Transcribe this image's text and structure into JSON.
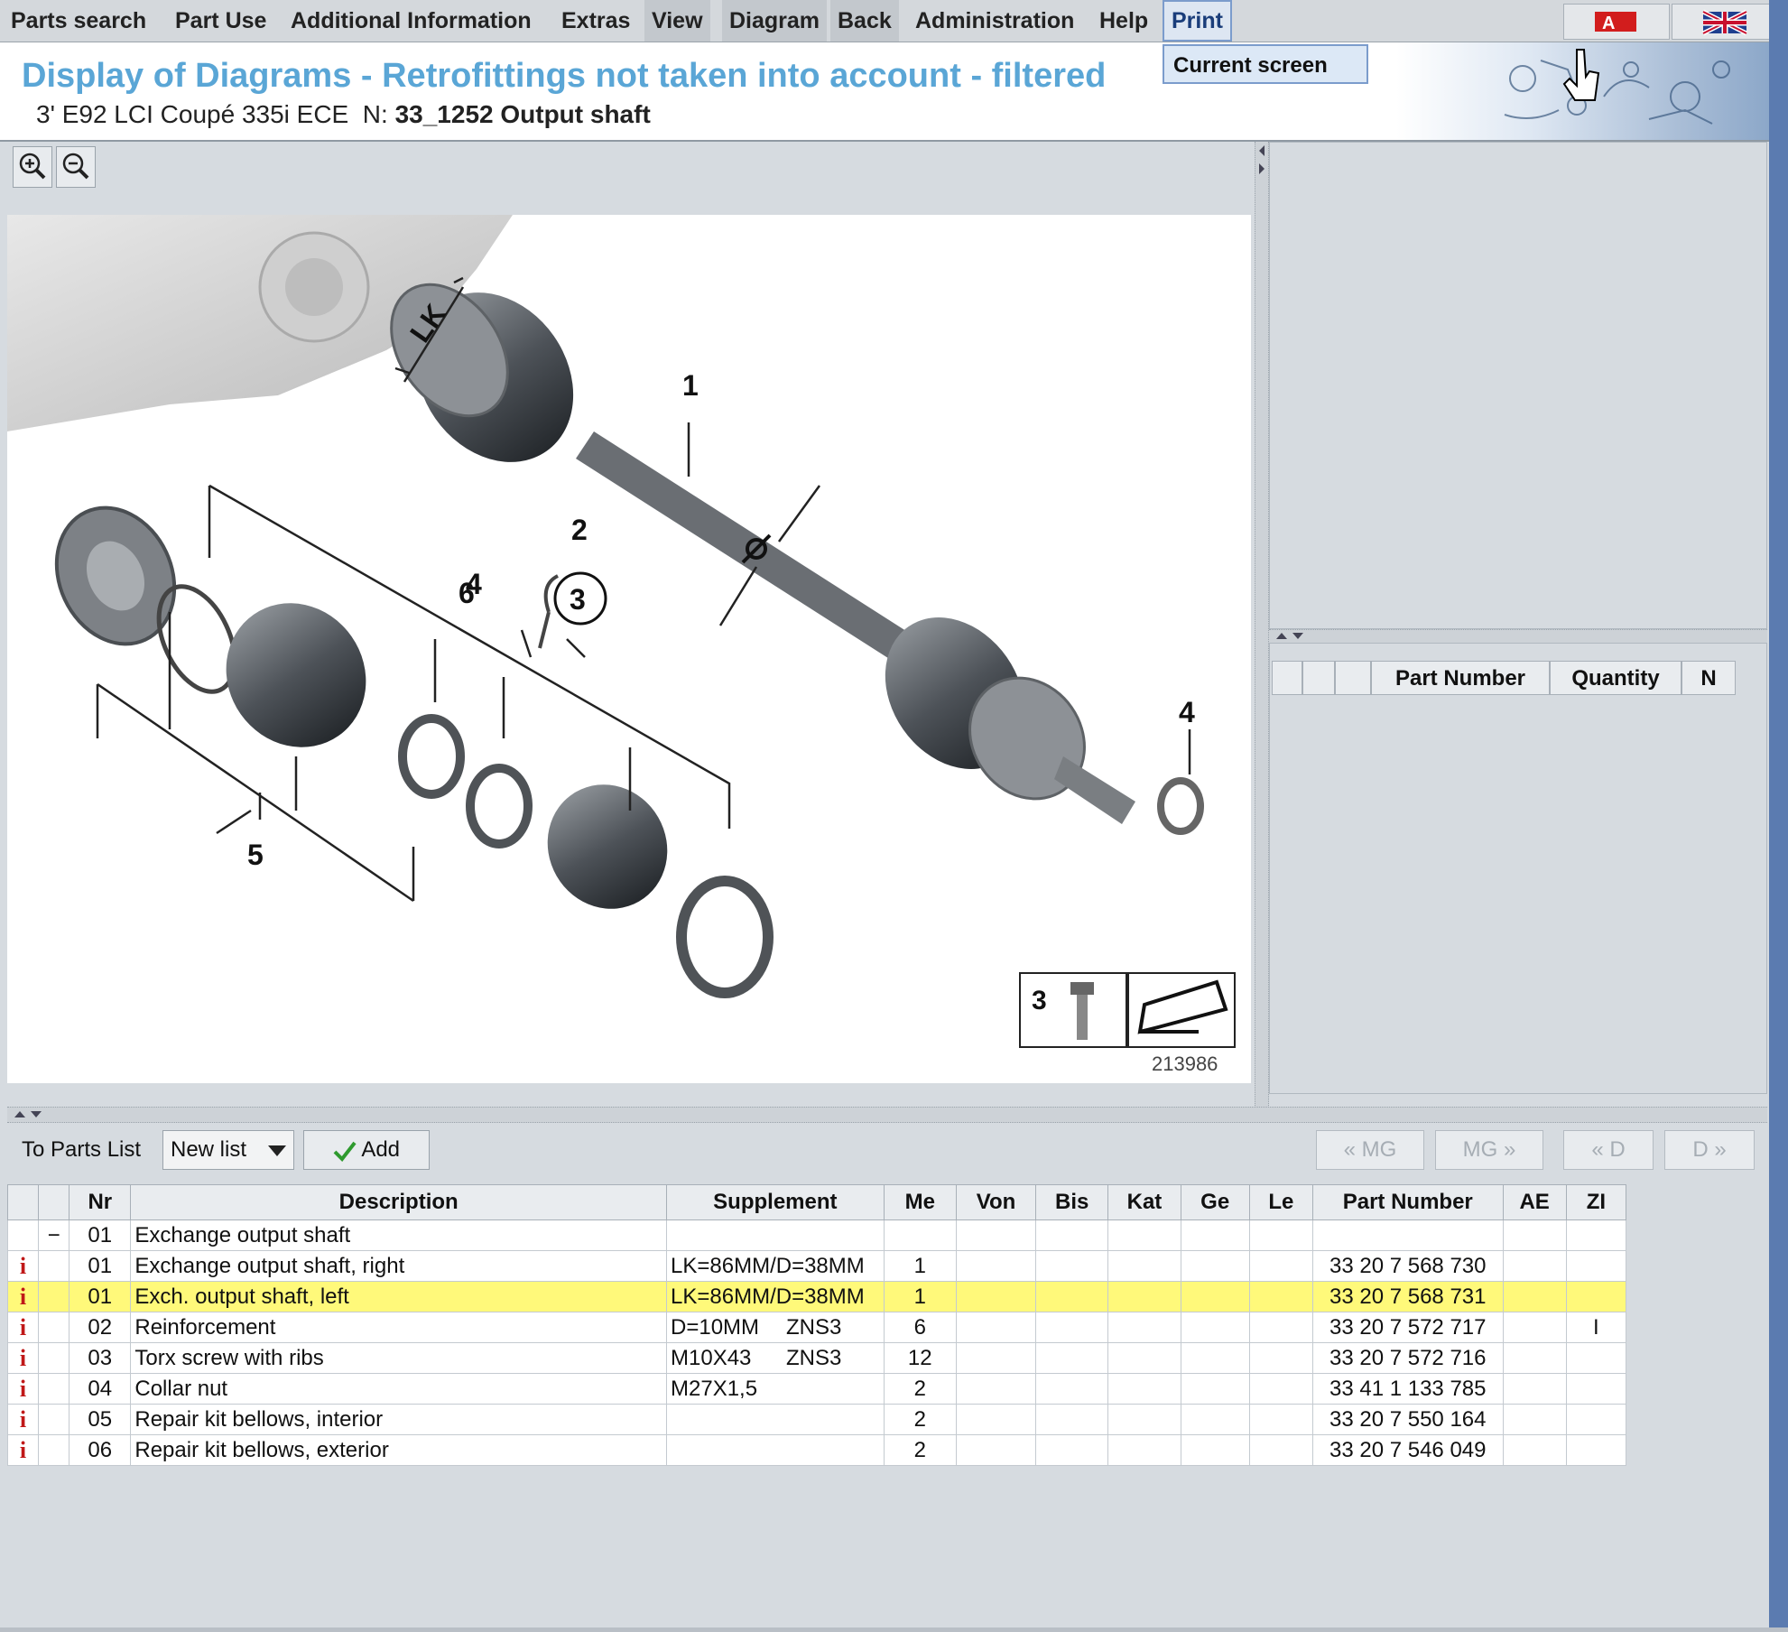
{
  "menu": {
    "items": [
      "Parts search",
      "Part Use",
      "Additional Information",
      "Extras",
      "View",
      "Diagram",
      "Back",
      "Administration",
      "Help",
      "Print"
    ],
    "print_dropdown": "Current screen"
  },
  "header": {
    "title": "Display of Diagrams - Retrofittings not taken into account - filtered",
    "vehicle": "3' E92 LCI Coupé 335i ECE",
    "diagram_prefix": "N:",
    "diagram_name": "33_1252 Output shaft"
  },
  "diagram": {
    "callouts": [
      "1",
      "2",
      "3",
      "4",
      "5",
      "6"
    ],
    "dimension_label": "LK",
    "legend_number": "3",
    "image_number": "213986"
  },
  "mini_table": {
    "columns": [
      "",
      "",
      "",
      "Part Number",
      "Quantity",
      "N"
    ]
  },
  "toolbar": {
    "to_parts_list_label": "To Parts List",
    "list_select": "New list",
    "add_label": "Add",
    "nav_buttons": [
      "« MG",
      "MG »",
      "« D",
      "D »"
    ]
  },
  "parts_table": {
    "columns": [
      "",
      "",
      "Nr",
      "Description",
      "Supplement",
      "Me",
      "Von",
      "Bis",
      "Kat",
      "Ge",
      "Le",
      "Part Number",
      "AE",
      "ZI"
    ],
    "rows": [
      {
        "info": "",
        "marker": "−",
        "nr": "01",
        "description": "Exchange output shaft",
        "supplement": "",
        "supplement2": "",
        "me": "",
        "part_number": "",
        "zi": "",
        "selected": false
      },
      {
        "info": "i",
        "marker": "",
        "nr": "01",
        "description": "Exchange output shaft, right",
        "supplement": "LK=86MM/D=38MM",
        "supplement2": "",
        "me": "1",
        "part_number": "33 20 7 568 730",
        "zi": "",
        "selected": false
      },
      {
        "info": "i",
        "marker": "",
        "nr": "01",
        "description": "Exch. output shaft, left",
        "supplement": "LK=86MM/D=38MM",
        "supplement2": "",
        "me": "1",
        "part_number": "33 20 7 568 731",
        "zi": "",
        "selected": true
      },
      {
        "info": "i",
        "marker": "",
        "nr": "02",
        "description": "Reinforcement",
        "supplement": "D=10MM",
        "supplement2": "ZNS3",
        "me": "6",
        "part_number": "33 20 7 572 717",
        "zi": "I",
        "selected": false
      },
      {
        "info": "i",
        "marker": "",
        "nr": "03",
        "description": "Torx screw with ribs",
        "supplement": "M10X43",
        "supplement2": "ZNS3",
        "me": "12",
        "part_number": "33 20 7 572 716",
        "zi": "",
        "selected": false
      },
      {
        "info": "i",
        "marker": "",
        "nr": "04",
        "description": "Collar nut",
        "supplement": "M27X1,5",
        "supplement2": "",
        "me": "2",
        "part_number": "33 41 1 133 785",
        "zi": "",
        "selected": false
      },
      {
        "info": "i",
        "marker": "",
        "nr": "05",
        "description": "Repair kit bellows, interior",
        "supplement": "",
        "supplement2": "",
        "me": "2",
        "part_number": "33 20 7 550 164",
        "zi": "",
        "selected": false
      },
      {
        "info": "i",
        "marker": "",
        "nr": "06",
        "description": "Repair kit bellows, exterior",
        "supplement": "",
        "supplement2": "",
        "me": "2",
        "part_number": "33 20 7 546 049",
        "zi": "",
        "selected": false
      }
    ]
  },
  "colors": {
    "title": "#5aa6d6",
    "selected_row": "#fff97a",
    "info_icon": "#c01818"
  }
}
